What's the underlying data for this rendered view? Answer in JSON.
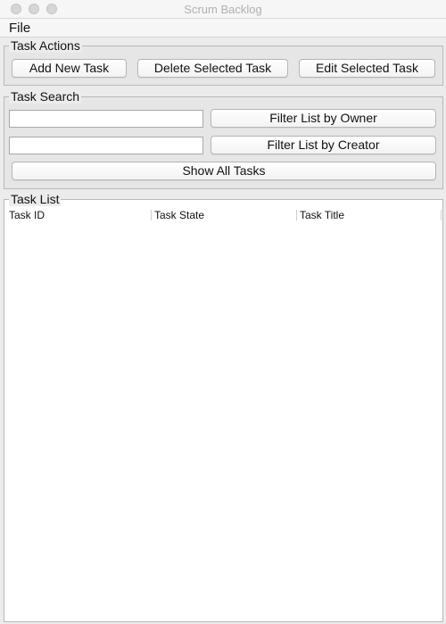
{
  "window": {
    "title": "Scrum Backlog"
  },
  "menubar": {
    "file": "File"
  },
  "task_actions": {
    "title": "Task Actions",
    "add": "Add New Task",
    "delete": "Delete Selected Task",
    "edit": "Edit Selected Task"
  },
  "task_search": {
    "title": "Task Search",
    "owner_value": "",
    "creator_value": "",
    "filter_owner": "Filter List by Owner",
    "filter_creator": "Filter List by Creator",
    "show_all": "Show All Tasks"
  },
  "task_list": {
    "title": "Task List",
    "columns": [
      "Task ID",
      "Task State",
      "Task Title"
    ],
    "rows": []
  }
}
